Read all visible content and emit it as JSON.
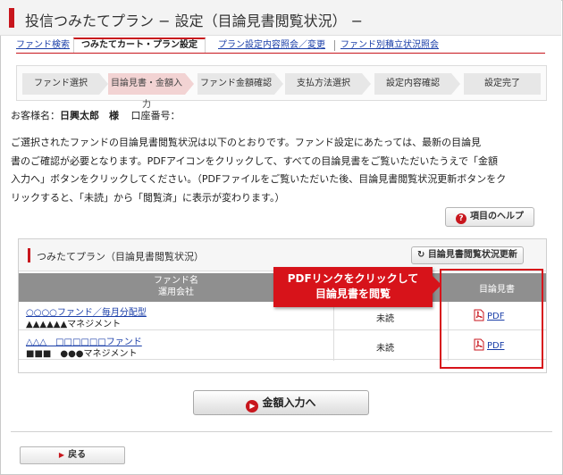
{
  "header": {
    "title": "投信つみたてプラン − 設定（目論見書閲覧状況） −"
  },
  "tabs": [
    {
      "label": "ファンド検索",
      "active": false
    },
    {
      "label": "つみたてカート・プラン設定",
      "active": true
    },
    {
      "label": "プラン設定内容照会／変更",
      "active": false
    },
    {
      "label": "ファンド別積立状況照会",
      "active": false
    }
  ],
  "steps": [
    {
      "label": "ファンド選択",
      "active": false
    },
    {
      "label": "目論見書・金額入力",
      "active": true
    },
    {
      "label": "ファンド金額確認",
      "active": false
    },
    {
      "label": "支払方法選択",
      "active": false
    },
    {
      "label": "設定内容確認",
      "active": false
    },
    {
      "label": "設定完了",
      "active": false
    }
  ],
  "customer": {
    "name_label": "お客様名：",
    "name": "日興太郎　様",
    "account_label": "口座番号：",
    "account": ""
  },
  "description": [
    "ご選択されたファンドの目論見書閲覧状況は以下のとおりです。ファンド設定にあたっては、最新の目論見",
    "書のご確認が必要となります。PDFアイコンをクリックして、すべての目論見書をご覧いただいたうえで「金額",
    "入力へ」ボタンをクリックしてください。（PDFファイルをご覧いただいた後、目論見書閲覧状況更新ボタンをク",
    "リックすると、「未読」から「閲覧済」に表示が変わります。）"
  ],
  "help_button": {
    "label": "項目のヘルプ",
    "icon": "question-icon"
  },
  "panel": {
    "title": "つみたてプラン（目論見書閲覧状況）",
    "update_button": "目論見書閲覧状況更新",
    "headers": {
      "fund_line1": "ファンド名",
      "fund_line2": "運用会社",
      "doc": "目論見書"
    },
    "rows": [
      {
        "fund": "○○○○ファンド／毎月分配型",
        "company": "▲▲▲▲▲▲マネジメント",
        "status": "未読",
        "pdf": "PDF"
      },
      {
        "fund": "△△△　□□□□□□ファンド",
        "company": "■■■　●●●マネジメント",
        "status": "未読",
        "pdf": "PDF"
      }
    ]
  },
  "callout": {
    "line1": "PDFリンクをクリックして",
    "line2": "目論見書を閲覧"
  },
  "amount_button": {
    "label": "金額入力へ"
  },
  "back_button": {
    "label": "戻る"
  },
  "colors": {
    "accent": "#c8161d",
    "link": "#1a3ea8",
    "callout": "#d7131a"
  }
}
